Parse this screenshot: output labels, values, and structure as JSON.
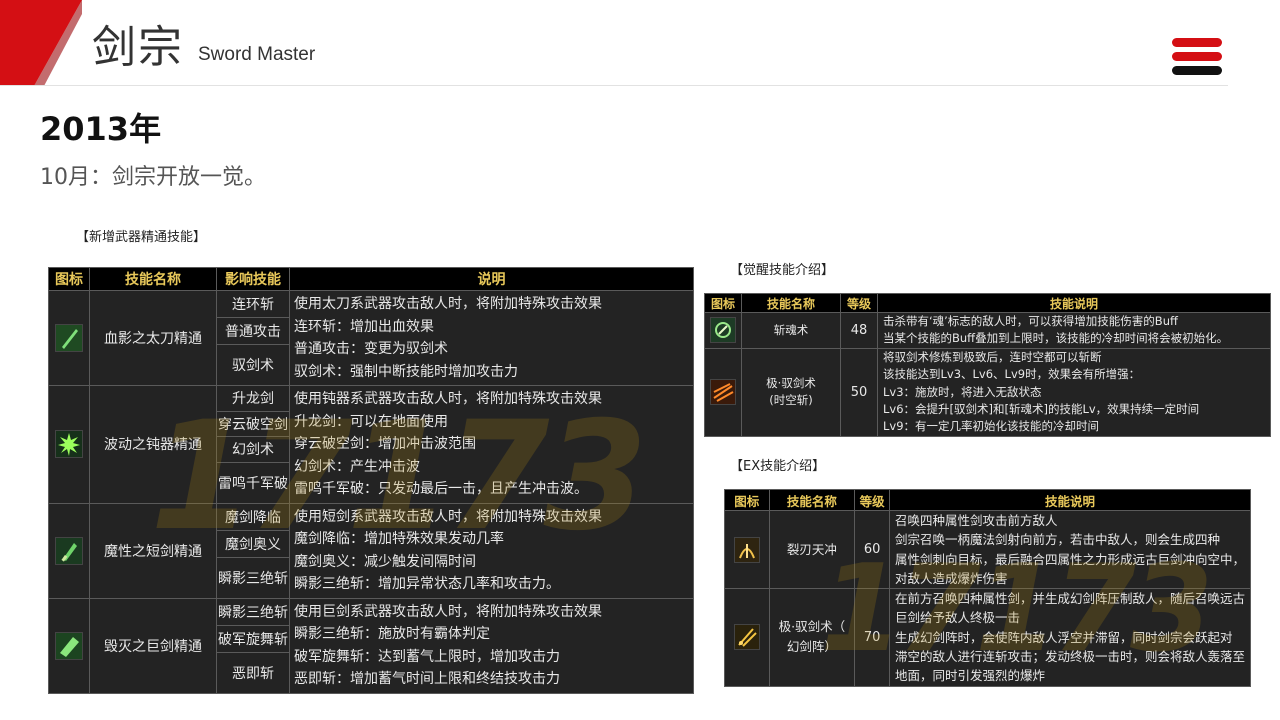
{
  "header": {
    "title_cn": "剑宗",
    "title_en": "Sword Master",
    "accent_color": "#d40f14",
    "menu_icon": "hamburger-menu-icon"
  },
  "main": {
    "year": "2013年",
    "subtitle": "10月：剑宗开放一觉。",
    "captions": {
      "weapon": "【新增武器精通技能】",
      "awaken": "【觉醒技能介绍】",
      "ex": "【EX技能介绍】"
    },
    "watermark": "17173"
  },
  "weapon_table": {
    "headers": [
      "图标",
      "技能名称",
      "影响技能",
      "说明"
    ],
    "rows": [
      {
        "icon": "katana-skill-icon",
        "name": "血影之太刀精通",
        "affected": [
          "连环斩",
          "普通攻击",
          "驭剑术"
        ],
        "desc": [
          "使用太刀系武器攻击敌人时，将附加特殊攻击效果",
          "连环斩：增加出血效果",
          "普通攻击：变更为驭剑术",
          "驭剑术：强制中断技能时增加攻击力"
        ]
      },
      {
        "icon": "blunt-weapon-skill-icon",
        "name": "波动之钝器精通",
        "affected": [
          "升龙剑",
          "穿云破空剑",
          "幻剑术",
          "雷鸣千军破"
        ],
        "desc": [
          "使用钝器系武器攻击敌人时，将附加特殊攻击效果",
          "升龙剑：可以在地面使用",
          "穿云破空剑：增加冲击波范围",
          "幻剑术：产生冲击波",
          "雷鸣千军破：只发动最后一击，且产生冲击波。"
        ]
      },
      {
        "icon": "short-sword-skill-icon",
        "name": "魔性之短剑精通",
        "affected": [
          "魔剑降临",
          "魔剑奥义",
          "瞬影三绝斩"
        ],
        "desc": [
          "使用短剑系武器攻击敌人时，将附加特殊攻击效果",
          "魔剑降临：增加特殊效果发动几率",
          "魔剑奥义：减少触发间隔时间",
          "瞬影三绝斩：增加异常状态几率和攻击力。"
        ]
      },
      {
        "icon": "greatsword-skill-icon",
        "name": "毁灭之巨剑精通",
        "affected": [
          "瞬影三绝斩",
          "破军旋舞斩",
          "恶即斩"
        ],
        "desc": [
          "使用巨剑系武器攻击敌人时，将附加特殊攻击效果",
          "瞬影三绝斩：施放时有霸体判定",
          "破军旋舞斩：达到蓄气上限时，增加攻击力",
          "恶即斩：增加蓄气时间上限和终结技攻击力"
        ]
      }
    ]
  },
  "awaken_table": {
    "headers": [
      "图标",
      "技能名称",
      "等级",
      "技能说明"
    ],
    "rows": [
      {
        "icon": "soul-slash-skill-icon",
        "name": "斩魂术",
        "level": "48",
        "desc": [
          "击杀带有‘魂’标志的敌人时，可以获得增加技能伤害的Buff",
          "当某个技能的Buff叠加到上限时，该技能的冷却时间将会被初始化。"
        ]
      },
      {
        "icon": "sword-control-skill-icon",
        "name": "极·驭剑术\n(时空斩)",
        "level": "50",
        "desc": [
          "将驭剑术修炼到极致后，连时空都可以斩断",
          "该技能达到Lv3、Lv6、Lv9时，效果会有所增强：",
          "Lv3：施放时，将进入无敌状态",
          "Lv6：会提升[驭剑术]和[斩魂术]的技能Lv，效果持续一定时间",
          "Lv9：有一定几率初始化该技能的冷却时间"
        ]
      }
    ]
  },
  "ex_table": {
    "headers": [
      "图标",
      "技能名称",
      "等级",
      "技能说明"
    ],
    "rows": [
      {
        "icon": "blade-split-skill-icon",
        "name": "裂刃天冲",
        "level": "60",
        "desc": [
          "召唤四种属性剑攻击前方敌人",
          "剑宗召唤一柄魔法剑射向前方，若击中敌人，则会生成四种",
          "属性剑刺向目标，最后融合四属性之力形成远古巨剑冲向空中，",
          "对敌人造成爆炸伤害"
        ]
      },
      {
        "icon": "phantom-sword-array-skill-icon",
        "name": "极·驭剑术（\n幻剑阵）",
        "level": "70",
        "desc": [
          "在前方召唤四种属性剑，并生成幻剑阵压制敌人，随后召唤远古",
          "巨剑给予敌人终极一击",
          "生成幻剑阵时，会使阵内敌人浮空并滞留，同时剑宗会跃起对",
          "滞空的敌人进行连斩攻击；发动终极一击时，则会将敌人轰落至",
          "地面，同时引发强烈的爆炸"
        ]
      }
    ]
  }
}
